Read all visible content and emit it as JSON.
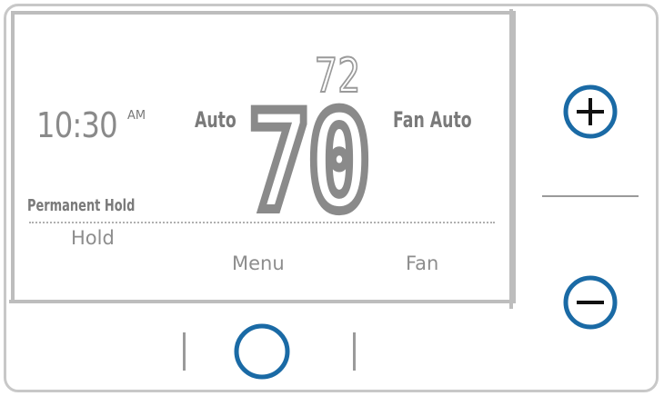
{
  "display": {
    "clock": "10:30",
    "ampm": "AM",
    "system_mode": "Auto",
    "fan_mode": "Fan Auto",
    "hold_status": "Permanent Hold",
    "setpoint_temp": "72",
    "current_temp": "70"
  },
  "soft_keys": {
    "hold": "Hold",
    "menu": "Menu",
    "fan": "Fan"
  },
  "buttons": {
    "up": "plus",
    "down": "minus",
    "select": "circle"
  },
  "colors": {
    "button_accent": "#1a6aa5",
    "lcd_segment": "#8a8a8a"
  }
}
